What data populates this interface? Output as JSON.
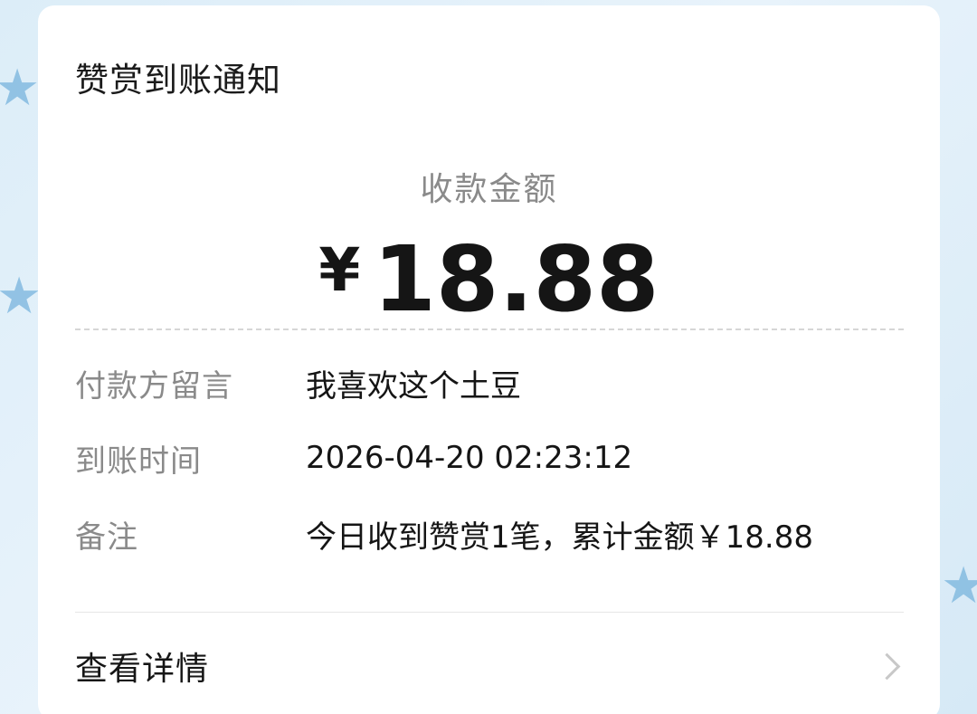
{
  "notification": {
    "title": "赞赏到账通知",
    "amount_label": "收款金额",
    "currency_symbol": "¥",
    "amount": "18.88"
  },
  "details": [
    {
      "label": "付款方留言",
      "value": "我喜欢这个土豆"
    },
    {
      "label": "到账时间",
      "value": "2026-04-20 02:23:12"
    },
    {
      "label": "备注",
      "value": "今日收到赞赏1笔，累计金额￥18.88"
    }
  ],
  "footer": {
    "view_details_label": "查看详情",
    "chevron_icon": "chevron-right-icon"
  },
  "colors": {
    "background": "#dcedf8",
    "card": "#ffffff",
    "label_gray": "#8a8a8a",
    "text_dark": "#151515",
    "star_blue": "#7fb8df"
  }
}
